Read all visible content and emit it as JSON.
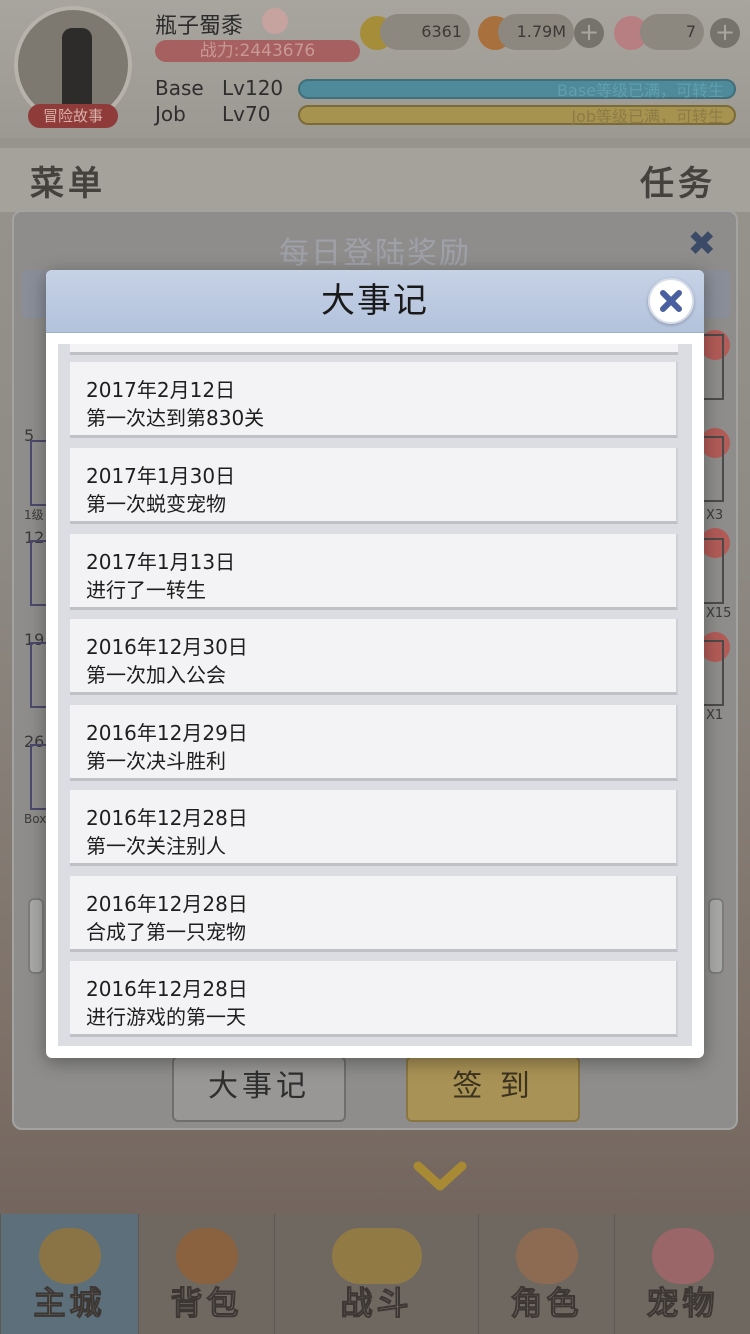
{
  "player": {
    "name": "瓶子蜀黍",
    "power": "战力:2443676",
    "avatar_tag": "冒险故事",
    "base_label": "Base",
    "base_level": "Lv120",
    "job_label": "Job",
    "job_level": "Lv70",
    "base_bar_text": "Base等级已满，可转生",
    "job_bar_text": "Job等级已满，可转生"
  },
  "resources": {
    "gold": "6361",
    "food": "1.79M",
    "pet_count": "7"
  },
  "top_menu": {
    "left": "菜单",
    "right": "任务"
  },
  "outer_panel": {
    "title": "每日登陆奖励",
    "side_numbers": [
      "5",
      "12",
      "19",
      "26"
    ],
    "side_small": [
      "1级",
      "Box"
    ],
    "side_counts": [
      "X3",
      "X15",
      "X1"
    ],
    "button_events": "大事记",
    "button_signin": "签 到"
  },
  "modal": {
    "title": "大事记",
    "events": [
      {
        "date": "2017年2月12日",
        "desc": "第一次达到第830关"
      },
      {
        "date": "2017年1月30日",
        "desc": "第一次蜕变宠物"
      },
      {
        "date": "2017年1月13日",
        "desc": "进行了一转生"
      },
      {
        "date": "2016年12月30日",
        "desc": "第一次加入公会"
      },
      {
        "date": "2016年12月29日",
        "desc": "第一次决斗胜利"
      },
      {
        "date": "2016年12月28日",
        "desc": "第一次关注别人"
      },
      {
        "date": "2016年12月28日",
        "desc": "合成了第一只宠物"
      },
      {
        "date": "2016年12月28日",
        "desc": "进行游戏的第一天"
      }
    ]
  },
  "bottom_nav": {
    "tabs": [
      {
        "label": "主城",
        "icon": "castle-icon"
      },
      {
        "label": "背包",
        "icon": "backpack-icon"
      },
      {
        "label": "战斗",
        "icon": "battle-icon"
      },
      {
        "label": "角色",
        "icon": "character-icon"
      },
      {
        "label": "宠物",
        "icon": "pet-icon"
      }
    ]
  },
  "colors": {
    "modal_header": "#b3c2dc",
    "close_x": "#4a5fa0",
    "signin_button": "#a99255",
    "active_tab": "#5c6f7a"
  }
}
